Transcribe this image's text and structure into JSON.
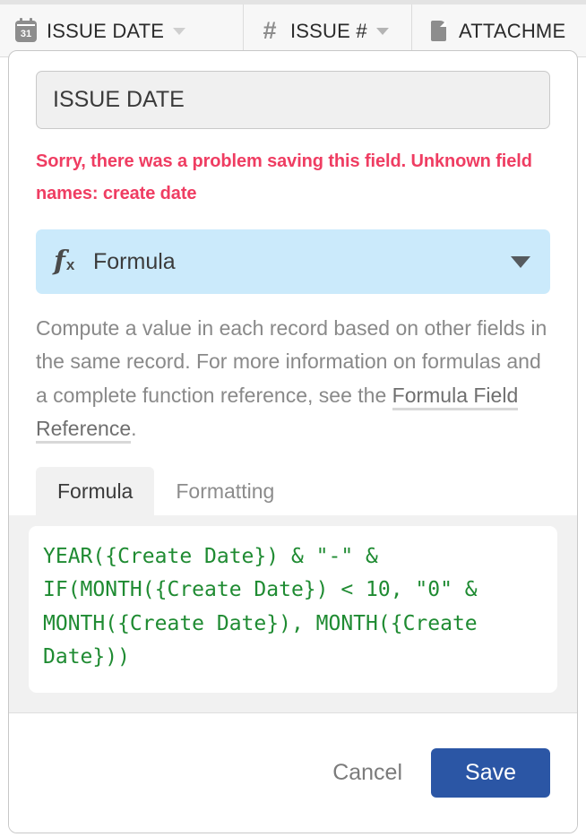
{
  "grid_header": {
    "columns": [
      {
        "label": "ISSUE DATE",
        "icon": "calendar-icon",
        "icon_text": "31",
        "has_caret": true
      },
      {
        "label": "ISSUE #",
        "icon": "hash-icon",
        "icon_text": "#",
        "has_caret": true
      },
      {
        "label": "ATTACHME",
        "icon": "attachment-icon",
        "icon_text": "",
        "has_caret": false
      }
    ]
  },
  "dialog": {
    "field_name": {
      "value": "ISSUE DATE",
      "placeholder": "Field name"
    },
    "error": "Sorry, there was a problem saving this field. Unknown field names: create date",
    "type_select": {
      "icon": "fx-icon",
      "value": "Formula",
      "caret": "chevron-down-icon"
    },
    "description": {
      "before_link": "Compute a value in each record based on other fields in the same record. For more information on formulas and a complete function reference, see the ",
      "link_text": "Formula Field Reference",
      "after_link": "."
    },
    "tabs": [
      {
        "label": "Formula",
        "active": true
      },
      {
        "label": "Formatting",
        "active": false
      }
    ],
    "formula": "YEAR({Create Date}) & \"-\" &\nIF(MONTH({Create Date}) < 10, \"0\" &\nMONTH({Create Date}), MONTH({Create\nDate}))",
    "footer": {
      "cancel_label": "Cancel",
      "save_label": "Save"
    }
  },
  "colors": {
    "error_pink": "#ef3d62",
    "type_select_blue": "#cbeafb",
    "formula_green": "#1f8b32",
    "save_blue": "#2b56a5",
    "panel_gray": "#f1f1f1"
  }
}
